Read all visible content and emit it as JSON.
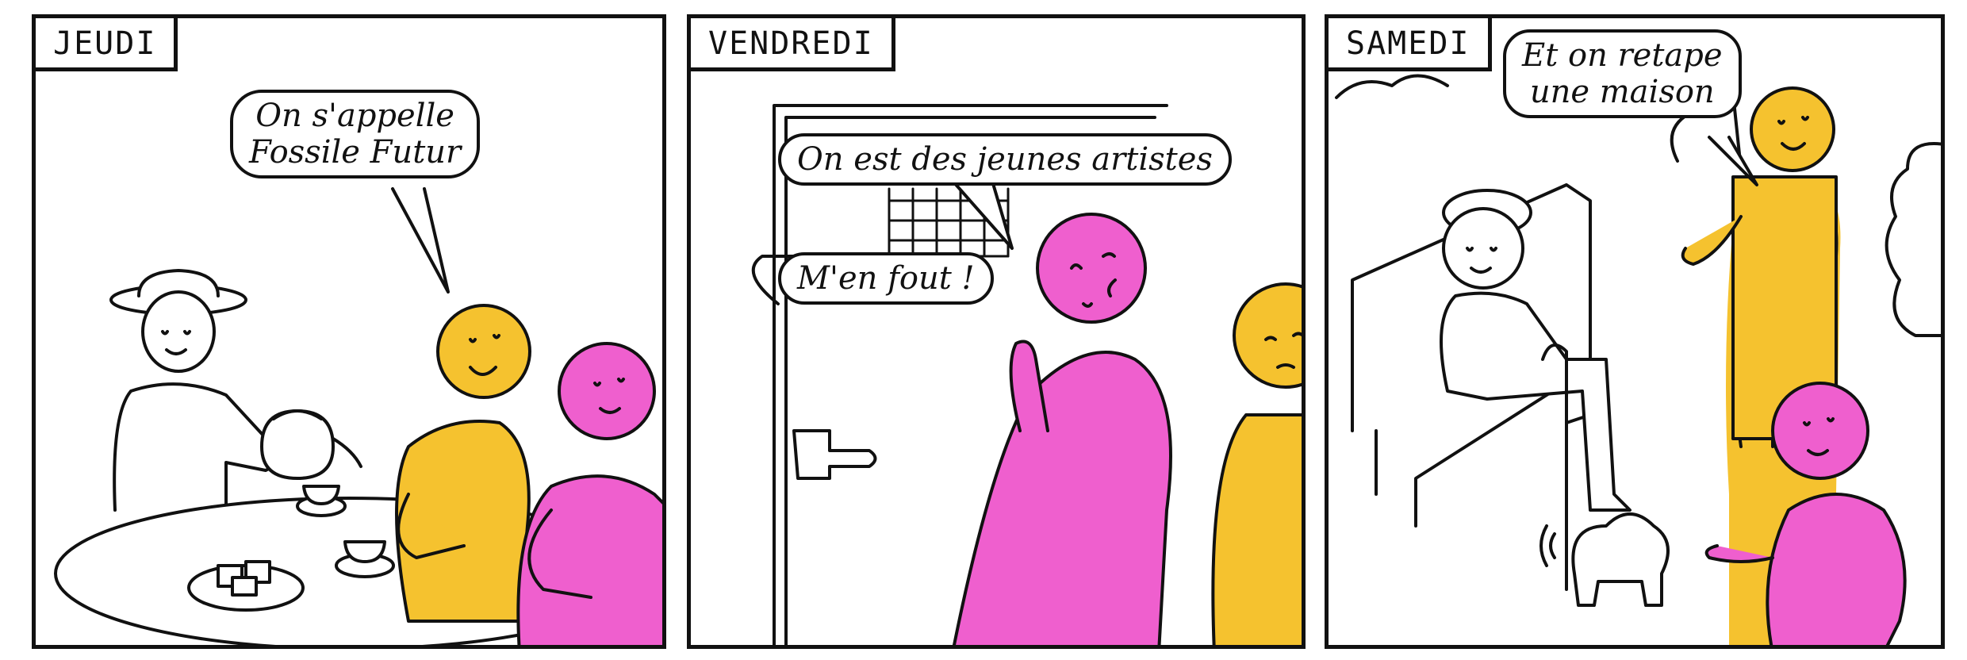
{
  "panels": [
    {
      "day": "JEUDI",
      "bubbles": [
        [
          "On s'appelle",
          "Fossile Futur"
        ]
      ]
    },
    {
      "day": "VENDREDI",
      "bubbles": [
        [
          "On est des jeunes artistes"
        ],
        [
          "M'en fout !"
        ]
      ]
    },
    {
      "day": "SAMEDI",
      "bubbles": [
        [
          "Et on retape",
          "une maison"
        ]
      ]
    }
  ],
  "colors": {
    "ink": "#111111",
    "yellow": "#f5c22f",
    "pink": "#ef5fce"
  }
}
